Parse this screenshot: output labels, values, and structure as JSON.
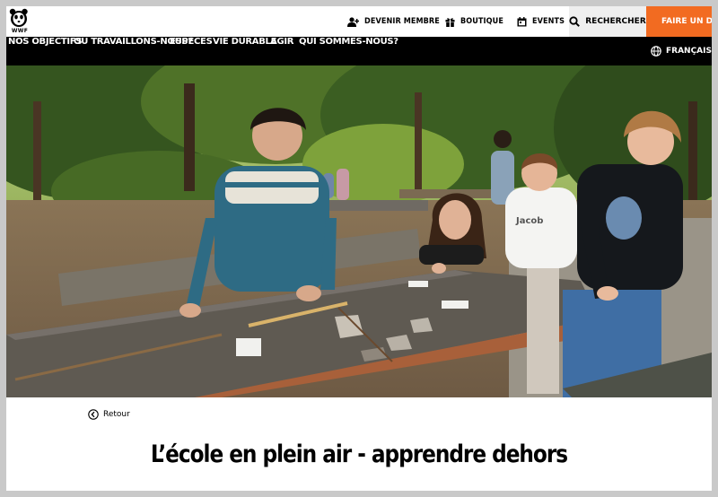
{
  "topbar": {
    "logo_text": "WWF",
    "become_member": "DEVENIR MEMBRE",
    "shop": "BOUTIQUE",
    "events": "EVENTS",
    "search": "RECHERCHER",
    "donate": "FAIRE UN DON"
  },
  "nav": {
    "items": [
      "NOS OBJECTIFS",
      "OÙ TRAVAILLONS-NOUS?",
      "ESPÈCES",
      "VIE DURABLE",
      "AGIR",
      "QUI SOMMES-NOUS?"
    ],
    "language": "FRANÇAIS"
  },
  "hero": {
    "shirt_text": "Jacob"
  },
  "back_link": "Retour",
  "page_title": "L’école en plein air - apprendre dehors",
  "colors": {
    "accent_orange": "#f26b21",
    "nav_background": "#000000",
    "search_background": "#efefef"
  }
}
